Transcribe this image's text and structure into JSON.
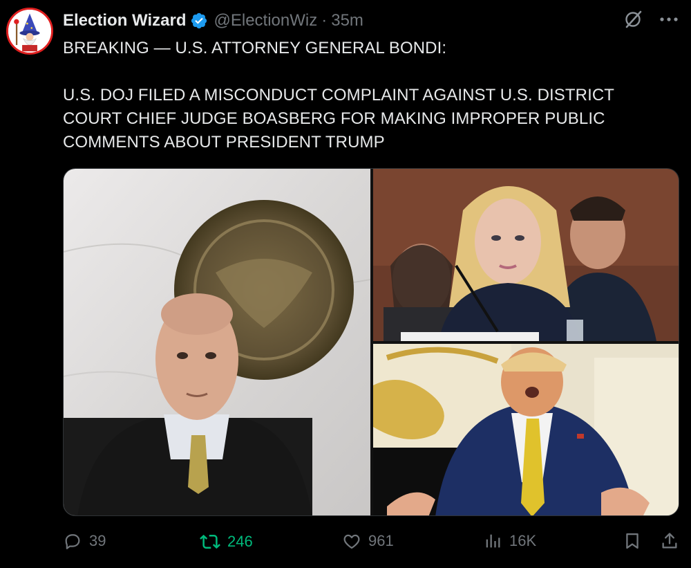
{
  "author": {
    "display_name": "Election Wizard",
    "handle": "@ElectionWiz",
    "separator": "·",
    "time": "35m",
    "verified": true,
    "avatar_icon": "wizard-icon"
  },
  "tweet": {
    "line1": "BREAKING — U.S. ATTORNEY GENERAL BONDI:",
    "line2": "U.S. DOJ FILED A MISCONDUCT COMPLAINT AGAINST U.S. DISTRICT COURT CHIEF JUDGE BOASBERG FOR MAKING IMPROPER PUBLIC COMMENTS ABOUT PRESIDENT TRUMP"
  },
  "media": {
    "images": [
      {
        "icon": "photo-judge-with-seal"
      },
      {
        "icon": "photo-woman-at-hearing"
      },
      {
        "icon": "photo-man-in-suit-gesturing"
      }
    ]
  },
  "actions": {
    "replies": "39",
    "retweets": "246",
    "likes": "961",
    "views": "16K"
  },
  "colors": {
    "background": "#000000",
    "text": "#e7e9ea",
    "muted": "#71767b",
    "verified": "#1d9bf0",
    "retweet_active": "#00ba7c"
  }
}
